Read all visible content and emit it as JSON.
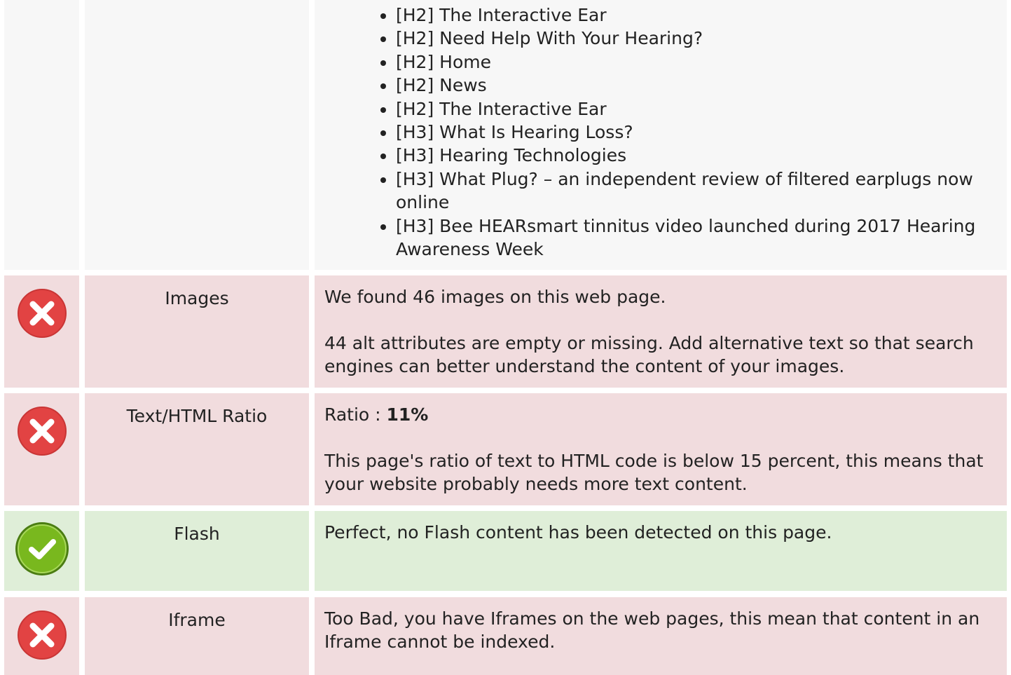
{
  "colors": {
    "error_row": "#f1dcde",
    "ok_row": "#dfeed8",
    "neutral_row": "#f7f7f7",
    "error_icon": "#e24343",
    "ok_icon": "#79b81e"
  },
  "headings_list": [
    "[H2] The Interactive Ear",
    "[H2] Need Help With Your Hearing?",
    "[H2] Home",
    "[H2] News",
    "[H2] The Interactive Ear",
    "[H3] What Is Hearing Loss?",
    "[H3] Hearing Technologies",
    "[H3] What Plug? – an independent review of filtered earplugs now online",
    "[H3] Bee HEARsmart tinnitus video launched during 2017 Hearing Awareness Week"
  ],
  "images": {
    "status_icon": "error-x-icon",
    "label": "Images",
    "line1": "We found 46 images on this web page.",
    "line2": "44 alt attributes are empty or missing. Add alternative text so that search engines can better understand the content of your images."
  },
  "ratio": {
    "status_icon": "error-x-icon",
    "label": "Text/HTML Ratio",
    "prefix": "Ratio : ",
    "value": "11%",
    "line2": "This page's ratio of text to HTML code is below 15 percent, this means that your website probably needs more text content."
  },
  "flash": {
    "status_icon": "check-icon",
    "label": "Flash",
    "line1": "Perfect, no Flash content has been detected on this page."
  },
  "iframe": {
    "status_icon": "error-x-icon",
    "label": "Iframe",
    "line1": "Too Bad, you have Iframes on the web pages, this mean that content in an Iframe cannot be indexed."
  }
}
